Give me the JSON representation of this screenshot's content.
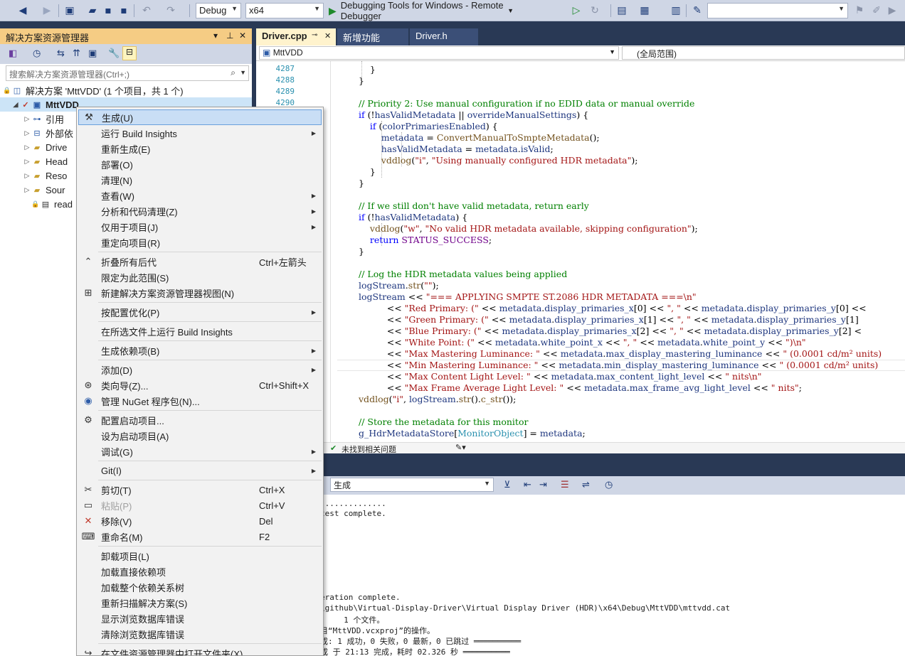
{
  "toolbar": {
    "config": "Debug",
    "platform": "x64",
    "debugger": "Debugging Tools for Windows - Remote Debugger",
    "search_box": ""
  },
  "solution_explorer": {
    "title": "解决方案资源管理器",
    "search_placeholder": "搜索解决方案资源管理器(Ctrl+;)",
    "solution": "解决方案 'MttVDD' (1 个项目，共 1 个)",
    "project": "MttVDD",
    "items": [
      "引用",
      "外部依",
      "Drive",
      "Head",
      "Reso",
      "Sour",
      "read"
    ]
  },
  "editor": {
    "tabs": [
      "Driver.cpp",
      "新增功能",
      "Driver.h"
    ],
    "nav_left": "MttVDD",
    "nav_right": "(全局范围)",
    "line_numbers": [
      "4287",
      "4288",
      "4289",
      "4290"
    ],
    "code_lines": [
      {
        "kind": "plain",
        "text": "    }"
      },
      {
        "kind": "plain",
        "text": "}"
      },
      {
        "kind": "plain",
        "text": ""
      },
      {
        "kind": "comment",
        "text": "// Priority 2: Use manual configuration if no EDID data or manual override"
      },
      {
        "kind": "mixed",
        "parts": [
          [
            "kw",
            "if"
          ],
          [
            "p",
            " (!"
          ],
          [
            "mb",
            "hasValidMetadata"
          ],
          [
            "p",
            " || "
          ],
          [
            "mb",
            "overrideManualSettings"
          ],
          [
            "p",
            ") {"
          ]
        ]
      },
      {
        "kind": "mixed",
        "parts": [
          [
            "p",
            "    "
          ],
          [
            "kw",
            "if"
          ],
          [
            "p",
            " ("
          ],
          [
            "mb",
            "colorPrimariesEnabled"
          ],
          [
            "p",
            ") {"
          ]
        ]
      },
      {
        "kind": "mixed",
        "parts": [
          [
            "p",
            "        "
          ],
          [
            "mb",
            "metadata"
          ],
          [
            "p",
            " = "
          ],
          [
            "fn",
            "ConvertManualToSmpteMetadata"
          ],
          [
            "p",
            "();"
          ]
        ]
      },
      {
        "kind": "mixed",
        "parts": [
          [
            "p",
            "        "
          ],
          [
            "mb",
            "hasValidMetadata"
          ],
          [
            "p",
            " = "
          ],
          [
            "mb",
            "metadata"
          ],
          [
            "p",
            "."
          ],
          [
            "mb",
            "isValid"
          ],
          [
            "p",
            ";"
          ]
        ]
      },
      {
        "kind": "mixed",
        "parts": [
          [
            "p",
            "        "
          ],
          [
            "fn",
            "vddlog"
          ],
          [
            "p",
            "("
          ],
          [
            "st",
            "\"i\""
          ],
          [
            "p",
            ", "
          ],
          [
            "st",
            "\"Using manually configured HDR metadata\""
          ],
          [
            "p",
            ");"
          ]
        ]
      },
      {
        "kind": "plain",
        "text": "    }"
      },
      {
        "kind": "plain",
        "text": "}"
      },
      {
        "kind": "plain",
        "text": ""
      },
      {
        "kind": "comment",
        "text": "// If we still don't have valid metadata, return early"
      },
      {
        "kind": "mixed",
        "parts": [
          [
            "kw",
            "if"
          ],
          [
            "p",
            " (!"
          ],
          [
            "mb",
            "hasValidMetadata"
          ],
          [
            "p",
            ") {"
          ]
        ]
      },
      {
        "kind": "mixed",
        "parts": [
          [
            "p",
            "    "
          ],
          [
            "fn",
            "vddlog"
          ],
          [
            "p",
            "("
          ],
          [
            "st",
            "\"w\""
          ],
          [
            "p",
            ", "
          ],
          [
            "st",
            "\"No valid HDR metadata available, skipping configuration\""
          ],
          [
            "p",
            ");"
          ]
        ]
      },
      {
        "kind": "mixed",
        "parts": [
          [
            "p",
            "    "
          ],
          [
            "kw",
            "return"
          ],
          [
            "p",
            " "
          ],
          [
            "mc",
            "STATUS_SUCCESS"
          ],
          [
            "p",
            ";"
          ]
        ]
      },
      {
        "kind": "plain",
        "text": "}"
      },
      {
        "kind": "plain",
        "text": ""
      },
      {
        "kind": "comment",
        "text": "// Log the HDR metadata values being applied"
      },
      {
        "kind": "mixed",
        "parts": [
          [
            "mb",
            "logStream"
          ],
          [
            "p",
            "."
          ],
          [
            "fn",
            "str"
          ],
          [
            "p",
            "("
          ],
          [
            "st",
            "\"\""
          ],
          [
            "p",
            ");"
          ]
        ]
      },
      {
        "kind": "mixed",
        "parts": [
          [
            "mb",
            "logStream"
          ],
          [
            "p",
            " << "
          ],
          [
            "st",
            "\"=== APPLYING SMPTE ST.2086 HDR METADATA ===\\n\""
          ]
        ]
      },
      {
        "kind": "mixed",
        "parts": [
          [
            "p",
            "          << "
          ],
          [
            "st",
            "\"Red Primary: (\""
          ],
          [
            "p",
            " << "
          ],
          [
            "mb",
            "metadata"
          ],
          [
            "p",
            "."
          ],
          [
            "mb",
            "display_primaries_x"
          ],
          [
            "p",
            "[0] << "
          ],
          [
            "st",
            "\", \""
          ],
          [
            "p",
            " << "
          ],
          [
            "mb",
            "metadata"
          ],
          [
            "p",
            "."
          ],
          [
            "mb",
            "display_primaries_y"
          ],
          [
            "p",
            "[0] <<"
          ]
        ]
      },
      {
        "kind": "mixed",
        "parts": [
          [
            "p",
            "          << "
          ],
          [
            "st",
            "\"Green Primary: (\""
          ],
          [
            "p",
            " << "
          ],
          [
            "mb",
            "metadata"
          ],
          [
            "p",
            "."
          ],
          [
            "mb",
            "display_primaries_x"
          ],
          [
            "p",
            "[1] << "
          ],
          [
            "st",
            "\", \""
          ],
          [
            "p",
            " << "
          ],
          [
            "mb",
            "metadata"
          ],
          [
            "p",
            "."
          ],
          [
            "mb",
            "display_primaries_y"
          ],
          [
            "p",
            "[1]"
          ]
        ]
      },
      {
        "kind": "mixed",
        "parts": [
          [
            "p",
            "          << "
          ],
          [
            "st",
            "\"Blue Primary: (\""
          ],
          [
            "p",
            " << "
          ],
          [
            "mb",
            "metadata"
          ],
          [
            "p",
            "."
          ],
          [
            "mb",
            "display_primaries_x"
          ],
          [
            "p",
            "[2] << "
          ],
          [
            "st",
            "\", \""
          ],
          [
            "p",
            " << "
          ],
          [
            "mb",
            "metadata"
          ],
          [
            "p",
            "."
          ],
          [
            "mb",
            "display_primaries_y"
          ],
          [
            "p",
            "[2] <"
          ]
        ]
      },
      {
        "kind": "mixed",
        "parts": [
          [
            "p",
            "          << "
          ],
          [
            "st",
            "\"White Point: (\""
          ],
          [
            "p",
            " << "
          ],
          [
            "mb",
            "metadata"
          ],
          [
            "p",
            "."
          ],
          [
            "mb",
            "white_point_x"
          ],
          [
            "p",
            " << "
          ],
          [
            "st",
            "\", \""
          ],
          [
            "p",
            " << "
          ],
          [
            "mb",
            "metadata"
          ],
          [
            "p",
            "."
          ],
          [
            "mb",
            "white_point_y"
          ],
          [
            "p",
            " << "
          ],
          [
            "st",
            "\")\\n\""
          ]
        ]
      },
      {
        "kind": "mixed",
        "parts": [
          [
            "p",
            "          << "
          ],
          [
            "st",
            "\"Max Mastering Luminance: \""
          ],
          [
            "p",
            " << "
          ],
          [
            "mb",
            "metadata"
          ],
          [
            "p",
            "."
          ],
          [
            "mb",
            "max_display_mastering_luminance"
          ],
          [
            "p",
            " << "
          ],
          [
            "st",
            "\" (0.0001 cd/m² units)"
          ]
        ]
      },
      {
        "kind": "mixed",
        "parts": [
          [
            "p",
            "          << "
          ],
          [
            "st",
            "\"Min Mastering Luminance: \""
          ],
          [
            "p",
            " << "
          ],
          [
            "mb",
            "metadata"
          ],
          [
            "p",
            "."
          ],
          [
            "mb",
            "min_display_mastering_luminance"
          ],
          [
            "p",
            " << "
          ],
          [
            "st",
            "\" (0.0001 cd/m² units)"
          ]
        ]
      },
      {
        "kind": "mixed",
        "parts": [
          [
            "p",
            "          << "
          ],
          [
            "st",
            "\"Max Content Light Level: \""
          ],
          [
            "p",
            " << "
          ],
          [
            "mb",
            "metadata"
          ],
          [
            "p",
            "."
          ],
          [
            "mb",
            "max_content_light_level"
          ],
          [
            "p",
            " << "
          ],
          [
            "st",
            "\" nits\\n\""
          ]
        ]
      },
      {
        "kind": "mixed",
        "parts": [
          [
            "p",
            "          << "
          ],
          [
            "st",
            "\"Max Frame Average Light Level: \""
          ],
          [
            "p",
            " << "
          ],
          [
            "mb",
            "metadata"
          ],
          [
            "p",
            "."
          ],
          [
            "mb",
            "max_frame_avg_light_level"
          ],
          [
            "p",
            " << "
          ],
          [
            "st",
            "\" nits\""
          ],
          [
            "p",
            ";"
          ]
        ]
      },
      {
        "kind": "mixed",
        "parts": [
          [
            "fn",
            "vddlog"
          ],
          [
            "p",
            "("
          ],
          [
            "st",
            "\"i\""
          ],
          [
            "p",
            ", "
          ],
          [
            "mb",
            "logStream"
          ],
          [
            "p",
            "."
          ],
          [
            "fn",
            "str"
          ],
          [
            "p",
            "()."
          ],
          [
            "fn",
            "c_str"
          ],
          [
            "p",
            "());"
          ]
        ]
      },
      {
        "kind": "plain",
        "text": ""
      },
      {
        "kind": "comment",
        "text": "// Store the metadata for this monitor"
      },
      {
        "kind": "mixed",
        "parts": [
          [
            "mb",
            "g_HdrMetadataStore"
          ],
          [
            "p",
            "["
          ],
          [
            "ty",
            "MonitorObject"
          ],
          [
            "p",
            "] = "
          ],
          [
            "mb",
            "metadata"
          ],
          [
            "p",
            ";"
          ]
        ]
      }
    ],
    "status_issues": "未找到相关问题"
  },
  "output": {
    "source": "生成",
    "lines": [
      "..............",
      "test complete.",
      "",
      "",
      "",
      "",
      "",
      "",
      "eration complete.",
      "\\github\\Virtual-Display-Driver\\Virtual Display Driver (HDR)\\x64\\Debug\\MttVDD\\mttvdd.cat",
      "     1 个文件。",
      "目“MttVDD.vcxproj”的操作。",
      "成: 1 成功，0 失败，0 最新，0 已跳过 ══════════",
      "成 于 21:13 完成，耗时 02.326 秒 ══════════"
    ]
  },
  "context_menu": {
    "items": [
      {
        "label": "生成(U)",
        "icon": "build-icon",
        "highlight": true
      },
      {
        "label": "运行 Build Insights",
        "submenu": true
      },
      {
        "label": "重新生成(E)"
      },
      {
        "label": "部署(O)"
      },
      {
        "label": "清理(N)"
      },
      {
        "label": "查看(W)",
        "submenu": true
      },
      {
        "label": "分析和代码清理(Z)",
        "submenu": true
      },
      {
        "label": "仅用于项目(J)",
        "submenu": true
      },
      {
        "label": "重定向项目(R)"
      },
      {
        "sep": true
      },
      {
        "label": "折叠所有后代",
        "icon": "collapse-icon",
        "key": "Ctrl+左箭头"
      },
      {
        "label": "限定为此范围(S)"
      },
      {
        "label": "新建解决方案资源管理器视图(N)",
        "icon": "new-view-icon"
      },
      {
        "sep": true
      },
      {
        "label": "按配置优化(P)",
        "submenu": true
      },
      {
        "sep": true
      },
      {
        "label": "在所选文件上运行 Build Insights"
      },
      {
        "sep": true
      },
      {
        "label": "生成依赖项(B)",
        "submenu": true
      },
      {
        "sep": true
      },
      {
        "label": "添加(D)",
        "submenu": true
      },
      {
        "label": "类向导(Z)...",
        "icon": "class-wizard-icon",
        "key": "Ctrl+Shift+X"
      },
      {
        "label": "管理 NuGet 程序包(N)...",
        "icon": "nuget-icon"
      },
      {
        "sep": true
      },
      {
        "label": "配置启动项目...",
        "icon": "gear-icon"
      },
      {
        "label": "设为启动项目(A)"
      },
      {
        "label": "调试(G)",
        "submenu": true
      },
      {
        "sep": true
      },
      {
        "label": "Git(I)",
        "submenu": true
      },
      {
        "sep": true
      },
      {
        "label": "剪切(T)",
        "icon": "cut-icon",
        "key": "Ctrl+X"
      },
      {
        "label": "粘贴(P)",
        "icon": "paste-icon",
        "key": "Ctrl+V",
        "disabled": true
      },
      {
        "label": "移除(V)",
        "icon": "remove-icon",
        "key": "Del"
      },
      {
        "label": "重命名(M)",
        "icon": "rename-icon",
        "key": "F2"
      },
      {
        "sep": true
      },
      {
        "label": "卸载项目(L)"
      },
      {
        "label": "加载直接依赖项"
      },
      {
        "label": "加载整个依赖关系树"
      },
      {
        "label": "重新扫描解决方案(S)"
      },
      {
        "label": "显示浏览数据库错误"
      },
      {
        "label": "清除浏览数据库错误"
      },
      {
        "sep": true
      },
      {
        "label": "在文件资源管理器中打开文件夹(X)",
        "icon": "open-folder-icon"
      }
    ]
  }
}
